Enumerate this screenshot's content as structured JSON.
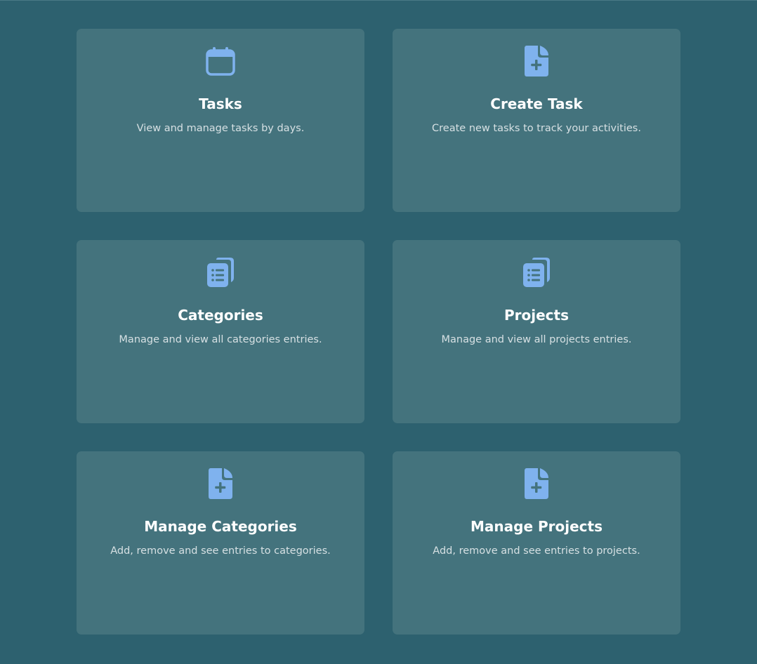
{
  "colors": {
    "background": "#2d616f",
    "card": "#44737d",
    "icon": "#7fb2ee",
    "title": "#ffffff",
    "description": "#d6e0e3"
  },
  "cards": [
    {
      "icon": "calendar-icon",
      "title": "Tasks",
      "description": "View and manage tasks by days."
    },
    {
      "icon": "file-add-icon",
      "title": "Create Task",
      "description": "Create new tasks to track your activities."
    },
    {
      "icon": "clipboard-list-icon",
      "title": "Categories",
      "description": "Manage and view all categories entries."
    },
    {
      "icon": "clipboard-list-icon",
      "title": "Projects",
      "description": "Manage and view all projects entries."
    },
    {
      "icon": "file-add-icon",
      "title": "Manage Categories",
      "description": "Add, remove and see entries to categories."
    },
    {
      "icon": "file-add-icon",
      "title": "Manage Projects",
      "description": "Add, remove and see entries to projects."
    }
  ]
}
